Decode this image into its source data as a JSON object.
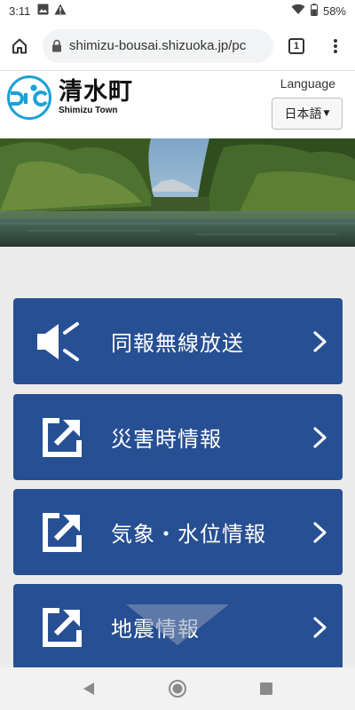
{
  "status_bar": {
    "time": "3:11",
    "battery": "58%",
    "icons": [
      "image-icon",
      "warning-icon",
      "wifi-icon",
      "battery-icon"
    ]
  },
  "browser": {
    "url": "shimizu-bousai.shizuoka.jp/pc",
    "tab_count": "1",
    "icons": [
      "home-icon",
      "lock-icon",
      "more-vert-icon"
    ]
  },
  "header": {
    "logo_jp": "清水町",
    "logo_en": "Shimizu Town",
    "language_label": "Language",
    "language_selected": "日本語"
  },
  "menu": {
    "items": [
      {
        "label": "同報無線放送",
        "icon": "megaphone-icon"
      },
      {
        "label": "災害時情報",
        "icon": "external-link-icon"
      },
      {
        "label": "気象・水位情報",
        "icon": "external-link-icon"
      },
      {
        "label": "地震情報",
        "icon": "external-link-icon"
      }
    ]
  },
  "colors": {
    "menu_button": "#274f93",
    "logo_blue": "#1aa0d8",
    "background": "#ebebeb"
  },
  "nav_bar": {
    "icons": [
      "back-icon",
      "home-circle-icon",
      "recents-icon"
    ]
  }
}
